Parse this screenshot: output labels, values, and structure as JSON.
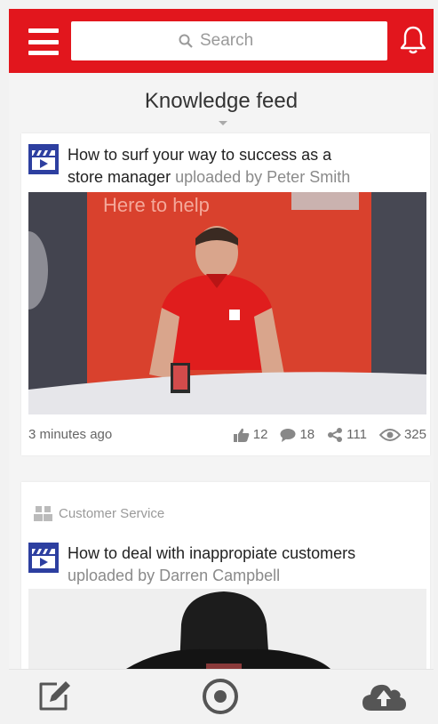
{
  "header": {
    "search_placeholder": "Search",
    "accent_color": "#e2161d"
  },
  "feed": {
    "title": "Knowledge feed"
  },
  "posts": [
    {
      "title": "How to surf your way to success as a",
      "title_line2": "store manager",
      "uploaded_by": "uploaded by Peter Smith",
      "thumbnail_text": "Here to help",
      "time": "3 minutes ago",
      "likes": "12",
      "comments": "18",
      "shares": "111",
      "views": "325"
    },
    {
      "category": "Customer Service",
      "title": "How to deal with inappropiate customers",
      "uploaded_by": "uploaded by Darren Campbell"
    }
  ],
  "icons": {
    "menu": "hamburger-menu-icon",
    "search": "magnifier-icon",
    "notifications": "bell-icon",
    "video": "video-clapper-icon",
    "likes": "thumbs-up-icon",
    "comments": "speech-bubble-icon",
    "shares": "share-icon",
    "views": "eye-icon",
    "category": "people-group-icon",
    "compose": "pencil-edit-icon",
    "record": "record-circle-icon",
    "upload": "cloud-upload-icon"
  }
}
